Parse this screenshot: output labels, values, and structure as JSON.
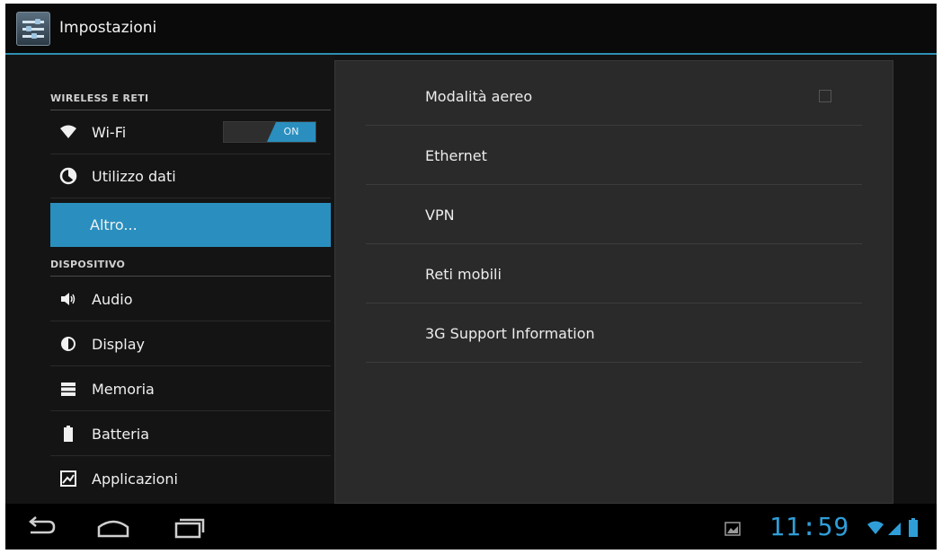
{
  "app": {
    "title": "Impostazioni",
    "icon": "settings-sliders-icon"
  },
  "sidebar": {
    "sections": [
      {
        "header": "WIRELESS E RETI"
      },
      {
        "header": "DISPOSITIVO"
      }
    ],
    "items": [
      {
        "label": "Wi-Fi",
        "icon": "wifi-icon",
        "toggle": "ON"
      },
      {
        "label": "Utilizzo dati",
        "icon": "data-usage-icon"
      },
      {
        "label": "Altro...",
        "icon": "",
        "selected": true
      },
      {
        "label": "Audio",
        "icon": "speaker-icon"
      },
      {
        "label": "Display",
        "icon": "brightness-icon"
      },
      {
        "label": "Memoria",
        "icon": "storage-icon"
      },
      {
        "label": "Batteria",
        "icon": "battery-icon"
      },
      {
        "label": "Applicazioni",
        "icon": "apps-icon"
      }
    ]
  },
  "content": {
    "items": [
      {
        "label": "Modalità aereo",
        "checkbox": false
      },
      {
        "label": "Ethernet"
      },
      {
        "label": "VPN"
      },
      {
        "label": "Reti mobili"
      },
      {
        "label": "3G Support Information"
      }
    ]
  },
  "navbar": {
    "buttons": [
      "back-icon",
      "home-icon",
      "recent-apps-icon"
    ],
    "status": {
      "time": "11:59",
      "icons": [
        "gallery-notification-icon",
        "wifi-signal-icon",
        "cell-signal-icon",
        "battery-status-icon"
      ]
    }
  },
  "colors": {
    "accent": "#2a8fbf",
    "clock": "#2f9ed8",
    "background": "#121212",
    "panel": "#2a2a2a"
  }
}
